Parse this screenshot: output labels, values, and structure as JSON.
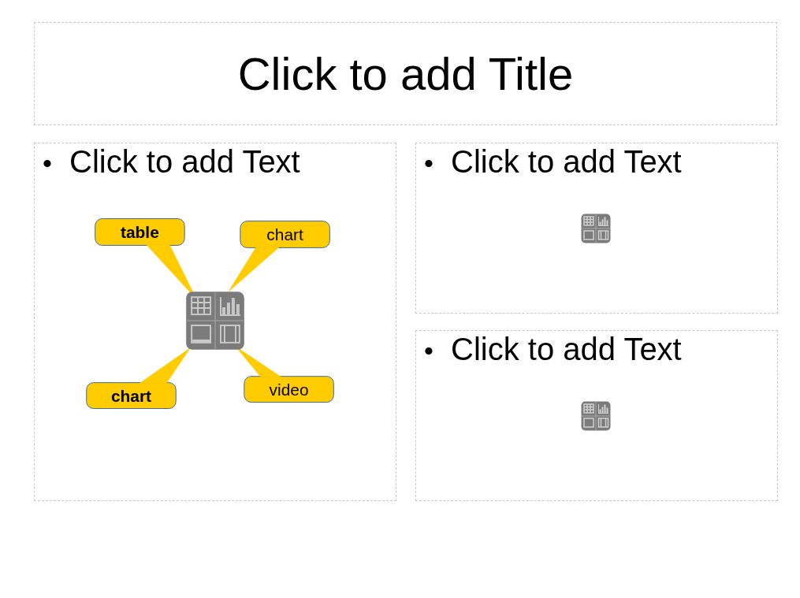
{
  "title": {
    "text": "Click to add Title"
  },
  "content_boxes": [
    {
      "bullet": "•",
      "text": "Click to add Text",
      "callouts": [
        {
          "text": "table",
          "bold": true
        },
        {
          "text": "chart",
          "bold": false
        },
        {
          "text": "chart",
          "bold": true
        },
        {
          "text": "video",
          "bold": false
        }
      ]
    },
    {
      "bullet": "•",
      "text": "Click to add Text"
    },
    {
      "bullet": "•",
      "text": "Click to add Text"
    }
  ]
}
